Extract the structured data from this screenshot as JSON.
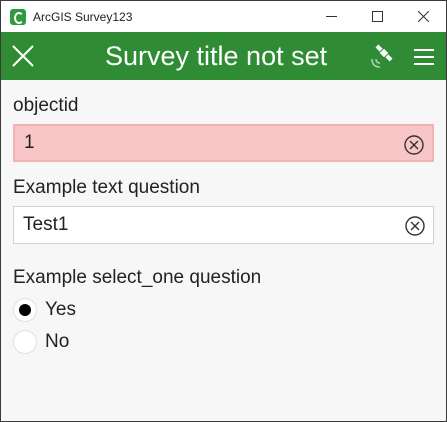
{
  "window": {
    "title": "ArcGIS Survey123"
  },
  "header": {
    "title": "Survey title not set"
  },
  "form": {
    "questions": [
      {
        "label": "objectid",
        "value": "1",
        "state": "error"
      },
      {
        "label": "Example text question",
        "value": "Test1",
        "state": "normal"
      }
    ],
    "select_one": {
      "label": "Example select_one question",
      "options": [
        {
          "label": "Yes",
          "selected": true
        },
        {
          "label": "No",
          "selected": false
        }
      ]
    }
  },
  "colors": {
    "header_green": "#2f8c34",
    "error_fill": "#f8c6c6"
  },
  "icons": {
    "app": "survey123-icon",
    "close": "close-icon",
    "gps": "satellite-icon",
    "menu": "menu-icon",
    "clear": "clear-circle-icon"
  }
}
